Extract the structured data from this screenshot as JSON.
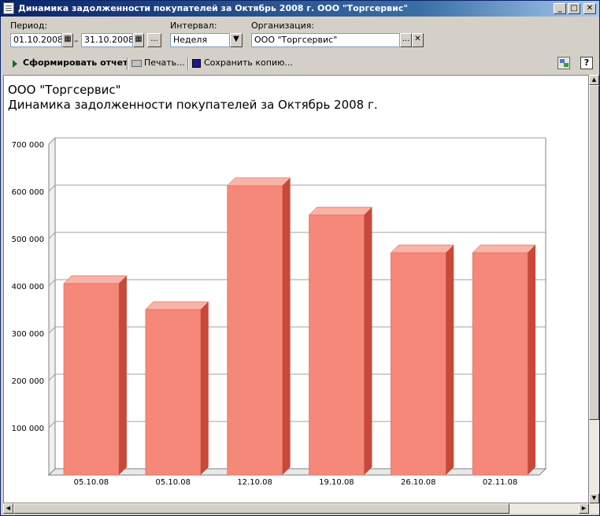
{
  "window": {
    "title": "Динамика задолженности покупателей за Октябрь 2008 г. ООО \"Торгсервис\"",
    "minimize": "_",
    "maximize": "□",
    "close": "✕"
  },
  "params": {
    "period_label": "Период:",
    "date_from": "01.10.2008",
    "dash": "–",
    "date_to": "31.10.2008",
    "period_more": "...",
    "interval_label": "Интервал:",
    "interval_value": "Неделя",
    "org_label": "Организация:",
    "org_value": "ООО \"Торгсервис\"",
    "org_more": "...",
    "org_clear": "✕"
  },
  "toolbar": {
    "generate": "Сформировать отчет",
    "print": "Печать...",
    "save": "Сохранить копию...",
    "help": "?"
  },
  "report": {
    "org": "ООО \"Торгсервис\"",
    "heading": "Динамика задолженности покупателей за Октябрь 2008 г."
  },
  "colors": {
    "bar_front": "#f58878",
    "bar_top": "#f9b3a8",
    "bar_side": "#c8483a"
  },
  "chart_data": {
    "type": "bar",
    "categories": [
      "05.10.08",
      "05.10.08",
      "12.10.08",
      "19.10.08",
      "26.10.08",
      "02.11.08"
    ],
    "values": [
      405000,
      350000,
      612000,
      550000,
      470000,
      470000
    ],
    "ylim": [
      0,
      700000
    ],
    "yticks": [
      "100 000",
      "200 000",
      "300 000",
      "400 000",
      "500 000",
      "600 000",
      "700 000"
    ],
    "ytick_values": [
      100000,
      200000,
      300000,
      400000,
      500000,
      600000,
      700000
    ],
    "grid": true
  }
}
